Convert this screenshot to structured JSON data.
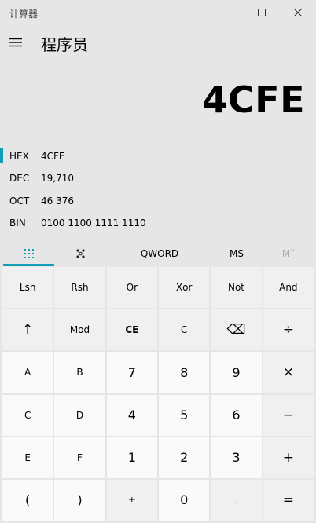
{
  "window": {
    "title": "计算器"
  },
  "header": {
    "mode_title": "程序员"
  },
  "display": {
    "value": "4CFE"
  },
  "radix": [
    {
      "label": "HEX",
      "value": "4CFE",
      "active": true
    },
    {
      "label": "DEC",
      "value": "19,710",
      "active": false
    },
    {
      "label": "OCT",
      "value": "46 376",
      "active": false
    },
    {
      "label": "BIN",
      "value": "0100 1100 1111 1110",
      "active": false
    }
  ],
  "tabs": {
    "keypad_icon": "full-keypad-icon",
    "bitflip_icon": "bit-toggle-keypad-icon",
    "word_size": "QWORD",
    "memory_store": "MS",
    "memory_recall": "M˅"
  },
  "keys": [
    [
      "Lsh",
      "Rsh",
      "Or",
      "Xor",
      "Not",
      "And"
    ],
    [
      "↑",
      "Mod",
      "CE",
      "C",
      "⌫",
      "÷"
    ],
    [
      "A",
      "B",
      "7",
      "8",
      "9",
      "×"
    ],
    [
      "C",
      "D",
      "4",
      "5",
      "6",
      "−"
    ],
    [
      "E",
      "F",
      "1",
      "2",
      "3",
      "+"
    ],
    [
      "(",
      ")",
      "±",
      "0",
      ".",
      "="
    ]
  ]
}
